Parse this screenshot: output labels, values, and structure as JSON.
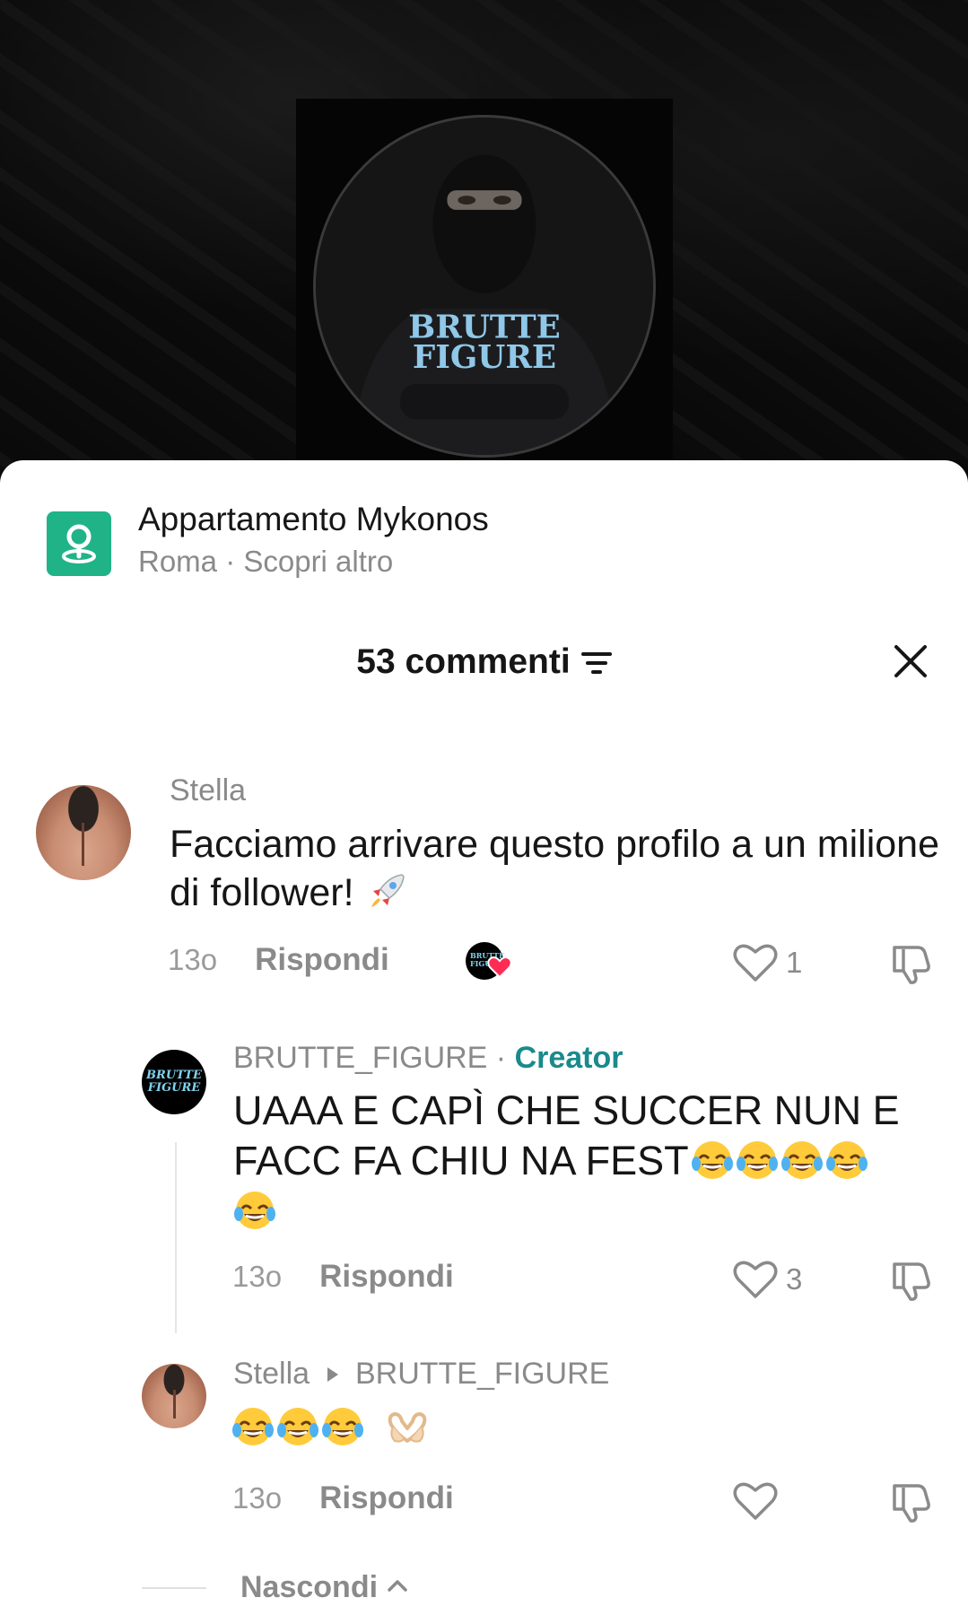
{
  "profile": {
    "hoodie_text_line1": "BRUTTE",
    "hoodie_text_line2": "FIGURE"
  },
  "location": {
    "title": "Appartamento Mykonos",
    "subtitle": "Roma · Scopri altro",
    "icon": "location-pin-icon",
    "icon_color": "#20b387"
  },
  "comments_header": {
    "title": "53 commenti",
    "filter_icon": "filter-icon",
    "close_icon": "close-icon"
  },
  "comments": [
    {
      "author": "Stella",
      "text": "Facciamo arrivare questo profilo a un milione di follower!",
      "emoji": "rocket",
      "time": "13o",
      "reply_label": "Rispondi",
      "likes": "1",
      "liked_by_creator": true
    },
    {
      "author": "BRUTTE_FIGURE",
      "author_sep": " · ",
      "badge": "Creator",
      "text_line1": "UAAA E CAPÌ CHE SUCCER NUN E",
      "text_line2": "FACC FA CHIU NA FEST",
      "emoji_count": 5,
      "time": "13o",
      "reply_label": "Rispondi",
      "likes": "3"
    },
    {
      "author": "Stella",
      "reply_to": "BRUTTE_FIGURE",
      "emoji_desc": "three laughing emojis and heart hands",
      "time": "13o",
      "reply_label": "Rispondi",
      "likes": ""
    }
  ],
  "avatar_text": {
    "line1": "BRUTTE",
    "line2": "FIGURE"
  },
  "hide_label": "Nascondi",
  "colors": {
    "creator_badge": "#1a8a8c",
    "secondary_text": "#8a8a8a",
    "primary_text": "#161616"
  }
}
